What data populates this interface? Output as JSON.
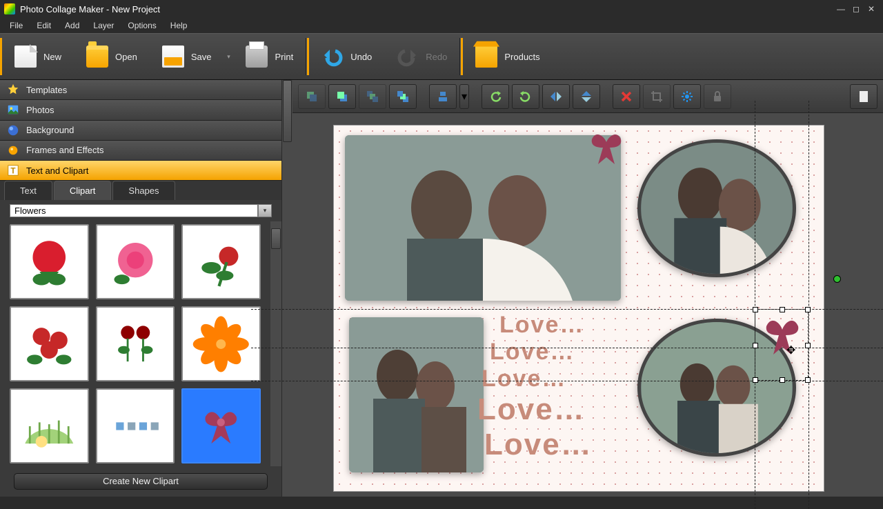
{
  "titlebar": {
    "title": "Photo Collage Maker - New Project"
  },
  "menu": {
    "file": "File",
    "edit": "Edit",
    "add": "Add",
    "layer": "Layer",
    "options": "Options",
    "help": "Help"
  },
  "toolbar": {
    "new": "New",
    "open": "Open",
    "save": "Save",
    "print": "Print",
    "undo": "Undo",
    "redo": "Redo",
    "products": "Products"
  },
  "sidebar": {
    "sections": {
      "templates": "Templates",
      "photos": "Photos",
      "background": "Background",
      "frames": "Frames and Effects",
      "textclipart": "Text and Clipart"
    },
    "tabs": {
      "text": "Text",
      "clipart": "Clipart",
      "shapes": "Shapes"
    },
    "category": "Flowers",
    "create_btn": "Create New Clipart"
  },
  "canvas": {
    "love_lines": [
      "Love…",
      "Love…",
      "Love…",
      "Love…",
      "Love…"
    ]
  }
}
